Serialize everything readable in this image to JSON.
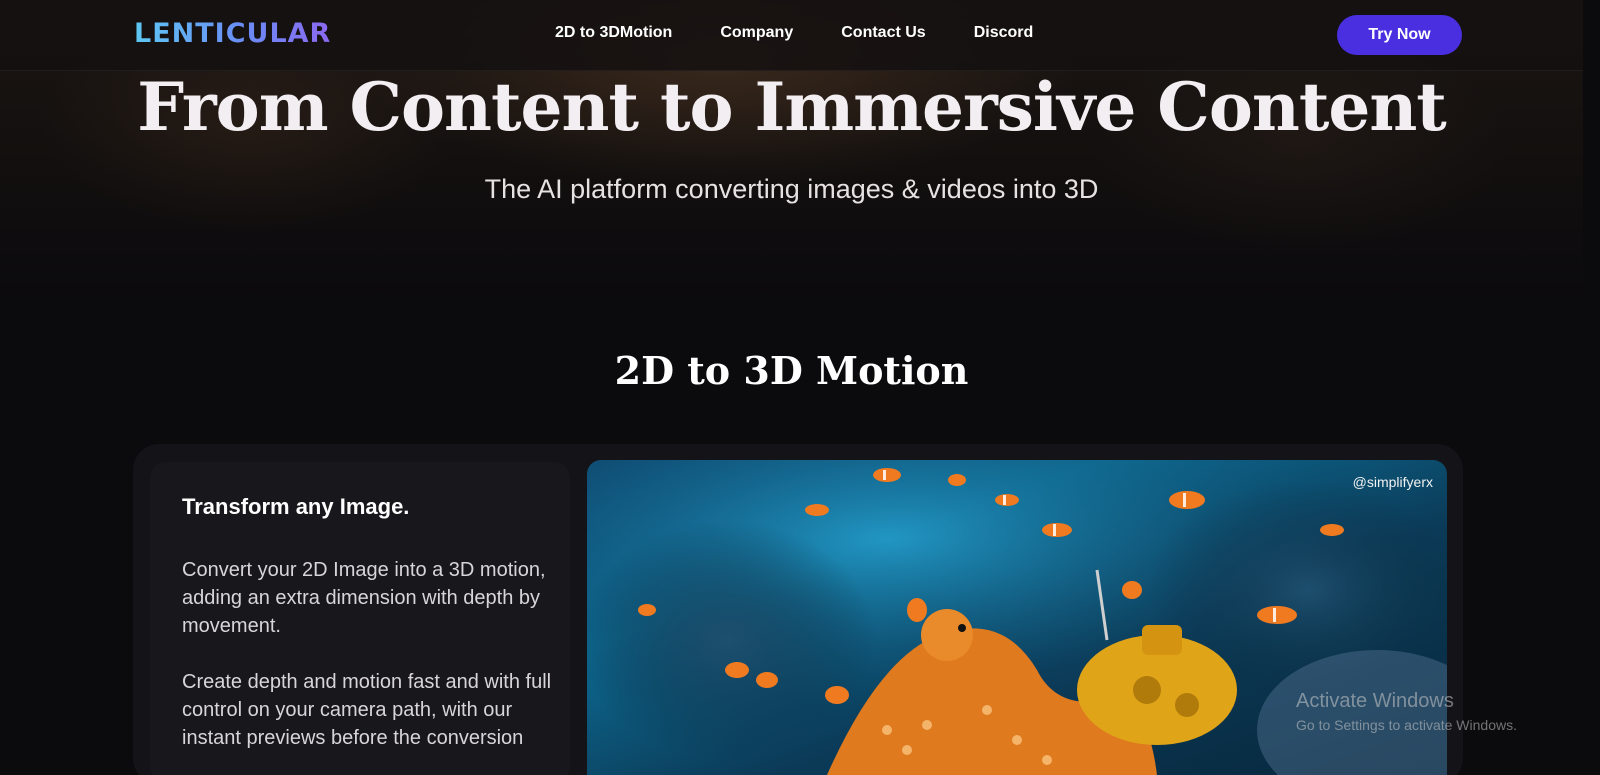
{
  "header": {
    "logo_text": "LENTICULAR",
    "nav": [
      {
        "label": "2D to 3DMotion"
      },
      {
        "label": "Company"
      },
      {
        "label": "Contact Us"
      },
      {
        "label": "Discord"
      }
    ],
    "cta_label": "Try Now"
  },
  "hero": {
    "title": "From Content to Immersive Content",
    "subtitle": "The AI platform converting images & videos into 3D"
  },
  "section": {
    "title": "2D to 3D Motion"
  },
  "feature": {
    "heading": "Transform any Image.",
    "paragraph1": "Convert your 2D Image into a 3D motion, adding an extra dimension with depth by movement.",
    "paragraph2": "Create depth and motion fast and with full control on your camera path, with our instant previews before the conversion",
    "image_credit": "@simplifyerx"
  },
  "os_watermark": {
    "title": "Activate Windows",
    "subtitle": "Go to Settings to activate Windows."
  },
  "colors": {
    "accent": "#4a2fe0",
    "background": "#0b0a0d",
    "logo_gradient": [
      "#5ec8f2",
      "#8b68f0"
    ]
  }
}
